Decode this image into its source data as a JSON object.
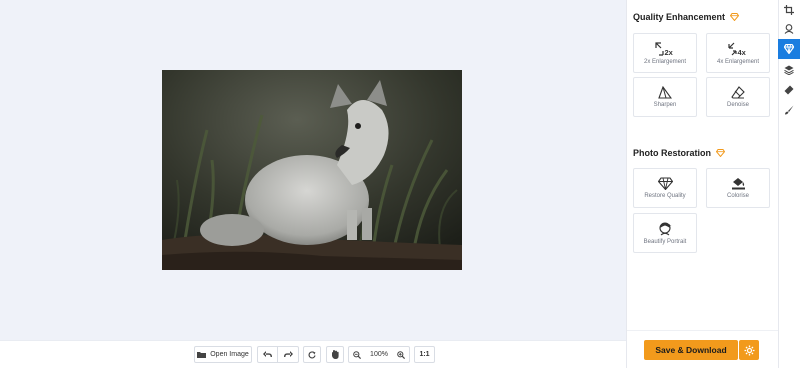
{
  "toolbar": {
    "open_image_label": "Open Image",
    "zoom_level": "100%",
    "actual_size_label": "1:1"
  },
  "panel": {
    "quality_title": "Quality Enhancement",
    "quality_tools": [
      {
        "label": "2x Enlargement",
        "badge": "2x"
      },
      {
        "label": "4x Enlargement",
        "badge": "4x"
      },
      {
        "label": "Sharpen"
      },
      {
        "label": "Denoise"
      }
    ],
    "restoration_title": "Photo Restoration",
    "restoration_tools": [
      {
        "label": "Restore Quality"
      },
      {
        "label": "Colorise"
      },
      {
        "label": "Beautify Portrait"
      }
    ],
    "save_label": "Save & Download"
  },
  "colors": {
    "accent_orange": "#f29a1c",
    "rail_active": "#1a7de0",
    "canvas_bg": "#eff2f9"
  },
  "icons": {
    "rail": [
      "crop-icon",
      "retouch-icon",
      "enhance-icon",
      "layers-icon",
      "eraser-icon",
      "brush-icon"
    ],
    "premium": "diamond-icon"
  }
}
